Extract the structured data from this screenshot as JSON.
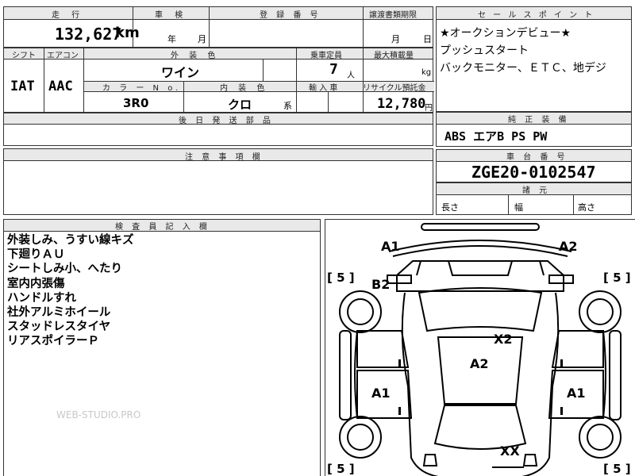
{
  "top_row": {
    "mileage_label": "走 行",
    "inspection_label": "車 検",
    "registration_label": "登 録 番 号",
    "transfer_label": "譲渡書類期限",
    "mileage_value": "132,627",
    "mileage_unit": "km",
    "year_unit": "年",
    "month_unit": "月",
    "transfer_month": "月",
    "transfer_day": "日"
  },
  "spec_row": {
    "shift_label": "シフト",
    "aircon_label": "エアコン",
    "exterior_color_label": "外 装 色",
    "capacity_label": "乗車定員",
    "max_load_label": "最大積載量",
    "shift_value": "IAT",
    "aircon_value": "AAC",
    "exterior_color_value": "ワイン",
    "capacity_value": "7",
    "capacity_unit": "人",
    "load_unit": "kg",
    "color_no_label": "カ ラ ー N o.",
    "interior_color_label": "内 装 色",
    "import_label": "輸 入 車",
    "recycle_label": "リサイクル預託金",
    "color_no_value": "3R0",
    "interior_color_value": "クロ",
    "interior_suffix": "系",
    "recycle_value": "12,780",
    "recycle_unit": "円"
  },
  "later_parts_label": "後 日 発 送 部 品",
  "caution_label": "注 意 事 項 欄",
  "sales": {
    "header": "セ ー ル ス ポ イ ン ト",
    "lines": [
      "★オークションデビュー★",
      "プッシュスタート",
      "バックモニター、ＥＴＣ、地デジ"
    ]
  },
  "equipment": {
    "header": "純 正 装 備",
    "value": "ABS エアB PS PW"
  },
  "chassis": {
    "header": "車 台 番 号",
    "value": "ZGE20-0102547"
  },
  "dimensions": {
    "header": "諸 元",
    "length_label": "長さ",
    "width_label": "幅",
    "height_label": "高さ"
  },
  "inspector": {
    "header": "検 査 員 記 入 欄",
    "lines": [
      "外装しみ、うすい線キズ",
      "下廻りＡＵ",
      "シートしみ小、へたり",
      "室内内張傷",
      "ハンドルすれ",
      "社外アルミホイール",
      "スタッドレスタイヤ",
      "リアスポイラーＰ"
    ]
  },
  "watermark": "WEB-STUDIO.PRO",
  "diagram": {
    "marks": {
      "front_left": "A1",
      "front_right": "A2",
      "left_front_fender": "B2",
      "roof": "X2",
      "center": "A2",
      "left_door": "A1",
      "right_door": "A1",
      "rear": "XX"
    },
    "tires": [
      "[ 5 ]",
      "[ 5 ]",
      "[ 5 ]",
      "[ 5 ]"
    ]
  }
}
